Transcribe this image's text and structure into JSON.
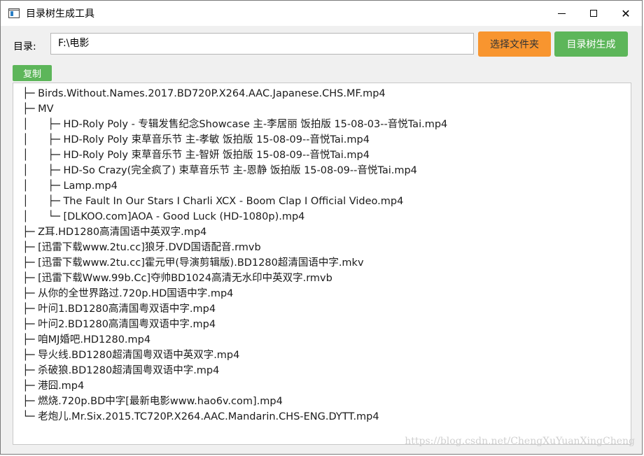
{
  "window": {
    "title": "目录树生成工具",
    "controls": {
      "close": "✕"
    }
  },
  "toolbar": {
    "dir_label": "目录:",
    "dir_value": "F:\\电影",
    "choose_folder": "选择文件夹",
    "generate": "目录树生成"
  },
  "copy_button": "复制",
  "tree": [
    "├─ Birds.Without.Names.2017.BD720P.X264.AAC.Japanese.CHS.MF.mp4",
    "├─ MV",
    "│      ├─ HD-Roly Poly - 专辑发售纪念Showcase 主-李居丽 饭拍版 15-08-03--音悦Tai.mp4",
    "│      ├─ HD-Roly Poly 束草音乐节 主-孝敏 饭拍版 15-08-09--音悦Tai.mp4",
    "│      ├─ HD-Roly Poly 束草音乐节 主-智妍 饭拍版 15-08-09--音悦Tai.mp4",
    "│      ├─ HD-So Crazy(完全疯了) 束草音乐节 主-恩静 饭拍版 15-08-09--音悦Tai.mp4",
    "│      ├─ Lamp.mp4",
    "│      ├─ The Fault In Our Stars I Charli XCX - Boom Clap I Official Video.mp4",
    "│      └─ [DLKOO.com]AOA - Good Luck (HD-1080p).mp4",
    "├─ Z耳.HD1280高清国语中英双字.mp4",
    "├─ [迅雷下载www.2tu.cc]狼牙.DVD国语配音.rmvb",
    "├─ [迅雷下载www.2tu.cc]霍元甲(导演剪辑版).BD1280超清国语中字.mkv",
    "├─ [迅雷下载Www.99b.Cc]夺帅BD1024高清无水印中英双字.rmvb",
    "├─ 从你的全世界路过.720p.HD国语中字.mp4",
    "├─ 叶问1.BD1280高清国粤双语中字.mp4",
    "├─ 叶问2.BD1280高清国粤双语中字.mp4",
    "├─ 咱MJ婚吧.HD1280.mp4",
    "├─ 导火线.BD1280超清国粤双语中英双字.mp4",
    "├─ 杀破狼.BD1280超清国粤双语中字.mp4",
    "├─ 港囧.mp4",
    "├─ 燃烧.720p.BD中字[最新电影www.hao6v.com].mp4",
    "└─ 老炮儿.Mr.Six.2015.TC720P.X264.AAC.Mandarin.CHS-ENG.DYTT.mp4"
  ],
  "watermark": "https://blog.csdn.net/ChengXuYuanXingCheng"
}
